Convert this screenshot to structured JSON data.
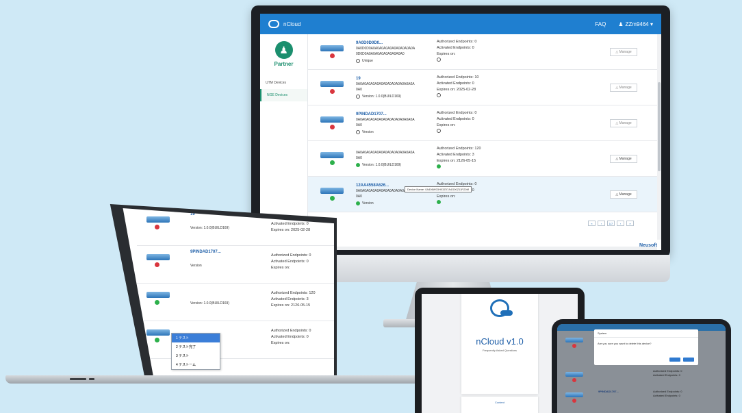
{
  "colors": {
    "background": "#cfe9f6",
    "header": "#1f7fd0",
    "partner": "#1b8f6e",
    "link": "#1f5fa8",
    "status_ok": "#2db04b",
    "status_err": "#d9363e"
  },
  "app": {
    "name": "nCloud",
    "faq": "FAQ",
    "user": "ZZm9464 ▾",
    "role": "Partner",
    "nav": [
      "UTM Devices",
      "NGE Devices"
    ],
    "brand": "Neusoft",
    "tooltip": "Device Name: 0A406W03H03Z07A4G00Z11R20M",
    "pager": [
      "«",
      "‹",
      "1/7",
      "›",
      "»"
    ]
  },
  "devices": [
    {
      "title": "9A0D0D0D0...",
      "sub1": "0A0D0D0A0A0A0A0A0A0A0A0A0A0A",
      "sub2": "0D0D0A0A0A0A0A0A0A0A0A0",
      "version": "Unique",
      "ep1": "Authorized Endpoints: 0",
      "ep2": "Activated Endpoints: 0",
      "expires": "Expires on:",
      "status": "err",
      "manage": "Manage"
    },
    {
      "title": "19",
      "sub1": "0A0A0A0A0A0A0A0A0A0A0A0A0A0A",
      "sub2": "0A0",
      "version": "Version: 1.0.0(BUILD169)",
      "ep1": "Authorized Endpoints: 10",
      "ep2": "Activated Endpoints: 0",
      "expires": "Expires on: 2025-02-28",
      "status": "err",
      "manage": "Manage"
    },
    {
      "title": "9PINDAD1707...",
      "sub1": "0A0A0A0A0A0A0A0A0A0A0A0A0A0A",
      "sub2": "0A0",
      "version": "Version",
      "ep1": "Authorized Endpoints: 0",
      "ep2": "Activated Endpoints: 0",
      "expires": "Expires on:",
      "status": "err",
      "manage": "Manage"
    },
    {
      "title": "",
      "sub1": "0A0A0A0A0A0A0A0A0A0A0A0A0A0A",
      "sub2": "0A0",
      "version": "Version: 1.0.0(BUILD169)",
      "ep1": "Authorized Endpoints: 120",
      "ep2": "Activated Endpoints: 3",
      "expires": "Expires on: 2126-05-15",
      "status": "ok",
      "manage": "Manage"
    },
    {
      "title": "12AA4558A626...",
      "sub1": "0A0A0A0A0A0A0A0A0A0A0A0A0A0A",
      "sub2": "0A0",
      "version": "Version",
      "ep1": "Authorized Endpoints: 0",
      "ep2": "Activated Endpoints: 0",
      "expires": "Expires on:",
      "status": "ok",
      "manage": "Manage"
    }
  ],
  "laptop": {
    "rows": [
      {
        "title": "19",
        "version": "Version: 1.0.0(BUILD169)",
        "ep1": "Authorized Endpoints: 10",
        "ep2": "Activated Endpoints: 0",
        "expires": "Expires on: 2025-02-28"
      },
      {
        "title": "9PINDAD1707...",
        "version": "Version",
        "ep1": "Authorized Endpoints: 0",
        "ep2": "Activated Endpoints: 0",
        "expires": "Expires on:"
      },
      {
        "title": "",
        "version": "Version: 1.0.0(BUILD169)",
        "ep1": "Authorized Endpoints: 120",
        "ep2": "Activated Endpoints: 3",
        "expires": "Expires on: 2126-05-15"
      },
      {
        "title": "",
        "version": "",
        "ep1": "Authorized Endpoints: 0",
        "ep2": "Activated Endpoints: 0",
        "expires": "Expires on:"
      }
    ],
    "menu": [
      "1 テスト",
      "2 テスト完了",
      "3 テスト",
      "4 テストーム"
    ]
  },
  "tablet": {
    "doc_title": "nCloud v1.0",
    "doc_sub": "Frequently Asked Questions",
    "toc": "Content"
  },
  "phone": {
    "dialog_title": "System",
    "dialog_msg": "Are you sure you want to delete this device?",
    "rows": [
      {
        "title": "",
        "ep1": "Authorized Endpoints: 0",
        "ep2": "Activated Endpoints: 0"
      },
      {
        "title": "9PINDAD1707...",
        "ep1": "Authorized Endpoints: 0",
        "ep2": "Activated Endpoints: 0"
      }
    ]
  }
}
